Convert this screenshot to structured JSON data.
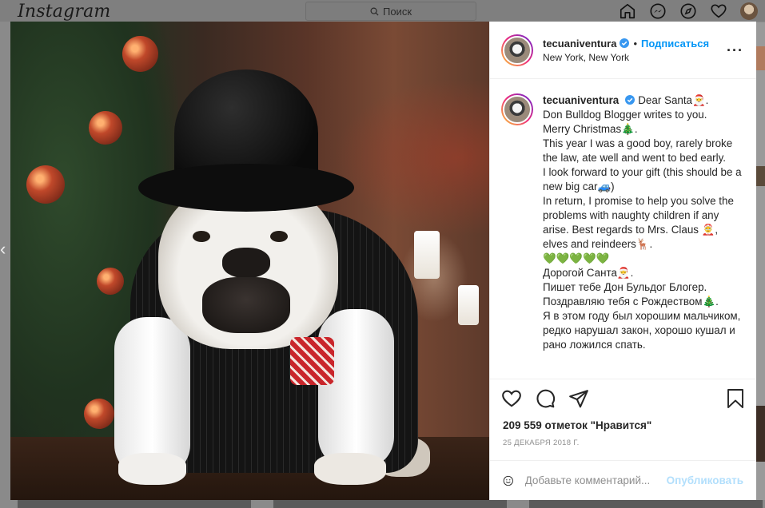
{
  "app": {
    "logo": "Instagram"
  },
  "search": {
    "placeholder": "Поиск"
  },
  "topbar": {
    "icons": [
      "home-icon",
      "messenger-icon",
      "explore-icon",
      "heart-icon",
      "profile-avatar"
    ]
  },
  "post": {
    "username": "tecuaniventura",
    "verified": true,
    "follow_label": "Подписаться",
    "separator": "•",
    "location": "New York, New York",
    "more_label": "···",
    "caption_first": "Dear Santa🎅.",
    "caption_lines": [
      "Don Bulldog Blogger writes to you.",
      "Merry Christmas🎄.",
      "This year I was a good boy, rarely broke the law, ate well and went to bed early.",
      "I look forward to your gift (this should be a new big car🚙)",
      "In return, I promise to help you solve the problems with naughty children if any arise. Best regards to Mrs. Claus 🤶, elves and reindeers🦌.",
      "💚💚💚💚💚",
      "Дорогой Санта🎅.",
      "Пишет тебе Дон Бульдог Блогер.",
      "Поздравляю тебя с Рождеством🎄.",
      "Я в этом году был хорошим мальчиком, редко нарушал закон, хорошо кушал и рано ложился спать."
    ],
    "likes": "209 559 отметок \"Нравится\"",
    "date": "25 декабря 2018 г.",
    "comment_placeholder": "Добавьте комментарий...",
    "post_button": "Опубликовать"
  },
  "colors": {
    "link": "#0095f6",
    "post_disabled": "#b2dffc",
    "muted": "#8e8e8e"
  }
}
